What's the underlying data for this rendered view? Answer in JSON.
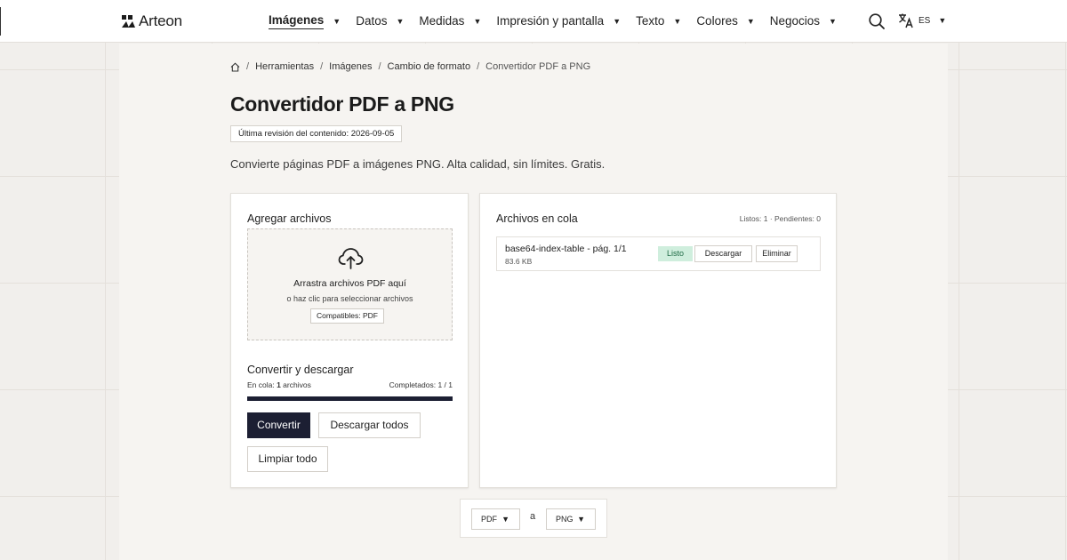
{
  "brand": {
    "name": "Arteon"
  },
  "nav": {
    "items": [
      {
        "label": "Imágenes",
        "active": true
      },
      {
        "label": "Datos",
        "active": false
      },
      {
        "label": "Medidas",
        "active": false
      },
      {
        "label": "Impresión y pantalla",
        "active": false
      },
      {
        "label": "Texto",
        "active": false
      },
      {
        "label": "Colores",
        "active": false
      },
      {
        "label": "Negocios",
        "active": false
      }
    ],
    "caret": "▼",
    "language": "ES"
  },
  "breadcrumb": {
    "separator": "/",
    "items": [
      "Herramientas",
      "Imágenes",
      "Cambio de formato",
      "Convertidor PDF a PNG"
    ]
  },
  "page": {
    "title": "Convertidor PDF a PNG",
    "review_label": "Última revisión del contenido: 2026-09-05",
    "description": "Convierte páginas PDF a imágenes PNG. Alta calidad, sin límites. Gratis."
  },
  "upload": {
    "title": "Agregar archivos",
    "dropzone_main": "Arrastra archivos PDF aquí",
    "dropzone_sub": "o haz clic para seleccionar archivos",
    "compatible": "Compatibles: PDF"
  },
  "convert": {
    "title": "Convertir y descargar",
    "queued_prefix": "En cola: ",
    "queued_count": "1",
    "queued_suffix": " archivos",
    "completed": "Completados: 1 / 1",
    "progress": 1.0,
    "convert_button": "Convertir",
    "download_all_button": "Descargar todos",
    "clear_button": "Limpiar todo"
  },
  "queue": {
    "title": "Archivos en cola",
    "stats": "Listos: 1 · Pendientes: 0",
    "files": [
      {
        "name": "base64-index-table - pág. 1/1",
        "size": "83.6 KB",
        "status": "Listo",
        "download": "Descargar",
        "remove": "Eliminar"
      }
    ]
  },
  "format": {
    "from": "PDF",
    "to": "PNG",
    "separator": "a"
  },
  "colors": {
    "primary": "#1c1f33",
    "badge_bg": "#cfeedd",
    "badge_text": "#1e6b45",
    "background": "#f1efec"
  },
  "icons": [
    "logo-mark-icon",
    "search-icon",
    "translate-icon",
    "home-icon",
    "cloud-upload-icon"
  ]
}
